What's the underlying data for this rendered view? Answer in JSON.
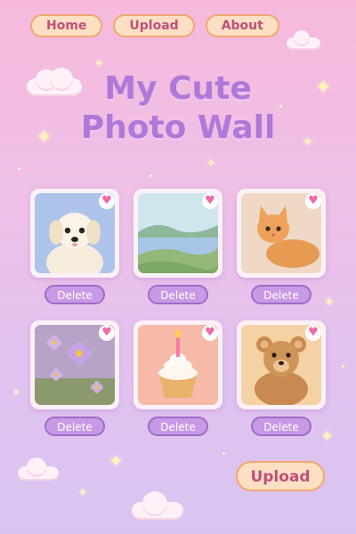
{
  "nav": {
    "items": [
      {
        "label": "Home",
        "name": "nav-home-button"
      },
      {
        "label": "Upload",
        "name": "nav-upload-button"
      },
      {
        "label": "About",
        "name": "nav-about-button"
      }
    ]
  },
  "title": {
    "line1": "My Cute",
    "line2": "Photo Wall"
  },
  "photos": [
    {
      "subject": "puppy",
      "delete_label": "Delete",
      "favorite_icon": "heart-icon"
    },
    {
      "subject": "lake-landscape",
      "delete_label": "Delete",
      "favorite_icon": "heart-icon"
    },
    {
      "subject": "kitten",
      "delete_label": "Delete",
      "favorite_icon": "heart-icon"
    },
    {
      "subject": "purple-daisies",
      "delete_label": "Delete",
      "favorite_icon": "heart-icon"
    },
    {
      "subject": "birthday-cupcake",
      "delete_label": "Delete",
      "favorite_icon": "heart-icon"
    },
    {
      "subject": "teddy-bear",
      "delete_label": "Delete",
      "favorite_icon": "heart-icon"
    }
  ],
  "upload": {
    "label": "Upload"
  },
  "colors": {
    "accent_pink": "#ef6aa6",
    "title_purple": "#b078d8",
    "button_peach": "#fde0c4",
    "delete_purple": "#c89ae6"
  }
}
